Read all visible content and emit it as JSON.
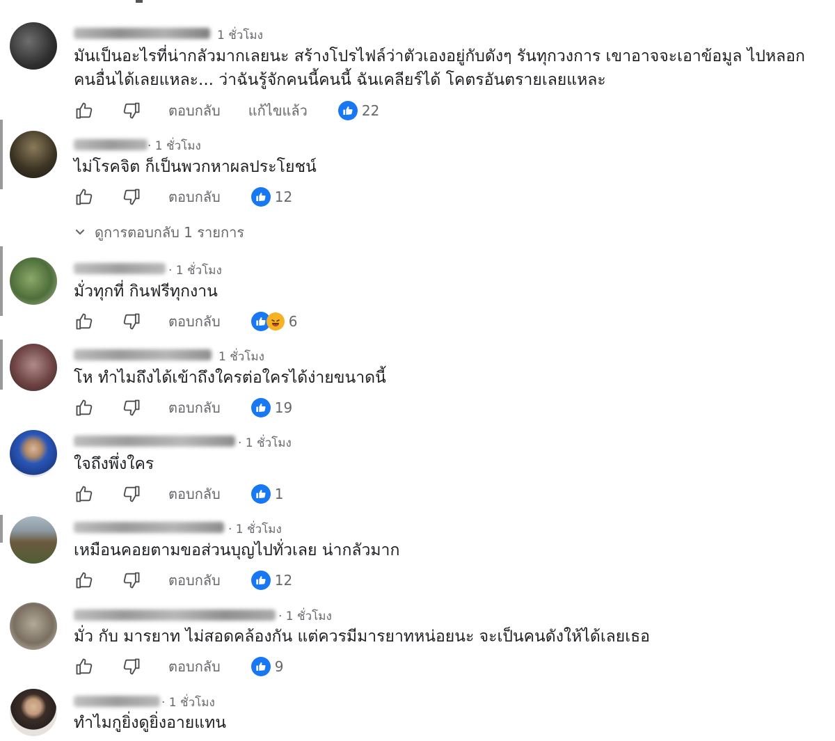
{
  "labels": {
    "reply": "ตอบกลับ",
    "edited": "แก้ไขแล้ว"
  },
  "view_replies_label": "ดูการตอบกลับ 1 รายการ",
  "colors": {
    "reaction_like": "#1877f2",
    "reaction_haha": "#f7b125",
    "secondary_text": "#65676b",
    "primary_text": "#1c1e21"
  },
  "icons": {
    "like": "thumbs-up-outline-icon",
    "dislike": "thumbs-down-outline-icon",
    "reaction_like": "like-reaction-icon",
    "reaction_haha": "haha-reaction-icon",
    "expand": "chevron-down-icon"
  },
  "comments": [
    {
      "time": "1 ชั่วโมง",
      "text": "มันเป็นอะไรที่น่ากลัวมากเลยนะ สร้างโปรไฟล์ว่าตัวเองอยู่กับดังๆ รันทุกวงการ เขาอาจจะเอาข้อมูล ไปหลอกคนอื่นได้เลยแหละ... ว่าฉันรู้จักคนนี้คนนี้ ฉันเคลียร์ได้ โคตรอันตรายเลยแหละ",
      "reaction_count": "22"
    },
    {
      "time": "· 1 ชั่วโมง",
      "text": "ไม่โรคจิต ก็เป็นพวกหาผลประโยชน์",
      "reaction_count": "12"
    },
    {
      "time": "· 1 ชั่วโมง",
      "text": "มั่วทุกที่ กินฟรีทุกงาน",
      "reaction_count": "6"
    },
    {
      "time": "1 ชั่วโมง",
      "text": "โห ทำไมถึงได้เข้าถึงใครต่อใครได้ง่ายขนาดนี้",
      "reaction_count": "19"
    },
    {
      "time": "· 1 ชั่วโมง",
      "text": "ใจถึงพึ่งใคร",
      "reaction_count": "1"
    },
    {
      "time": "· 1 ชั่วโมง",
      "text": "เหมือนคอยตามขอส่วนบุญไปทั่วเลย น่ากลัวมาก",
      "reaction_count": "12"
    },
    {
      "time": "· 1 ชั่วโมง",
      "text": "มั่ว กับ มารยาท ไม่สอดคล้องกัน แต่ควรมีมารยาทหน่อยนะ จะเป็นคนดังให้ได้เลยเธอ",
      "reaction_count": "9"
    },
    {
      "time": "· 1 ชั่วโมง",
      "text": "ทำไมกูยิ่งดูยิ่งอายแทน"
    }
  ]
}
